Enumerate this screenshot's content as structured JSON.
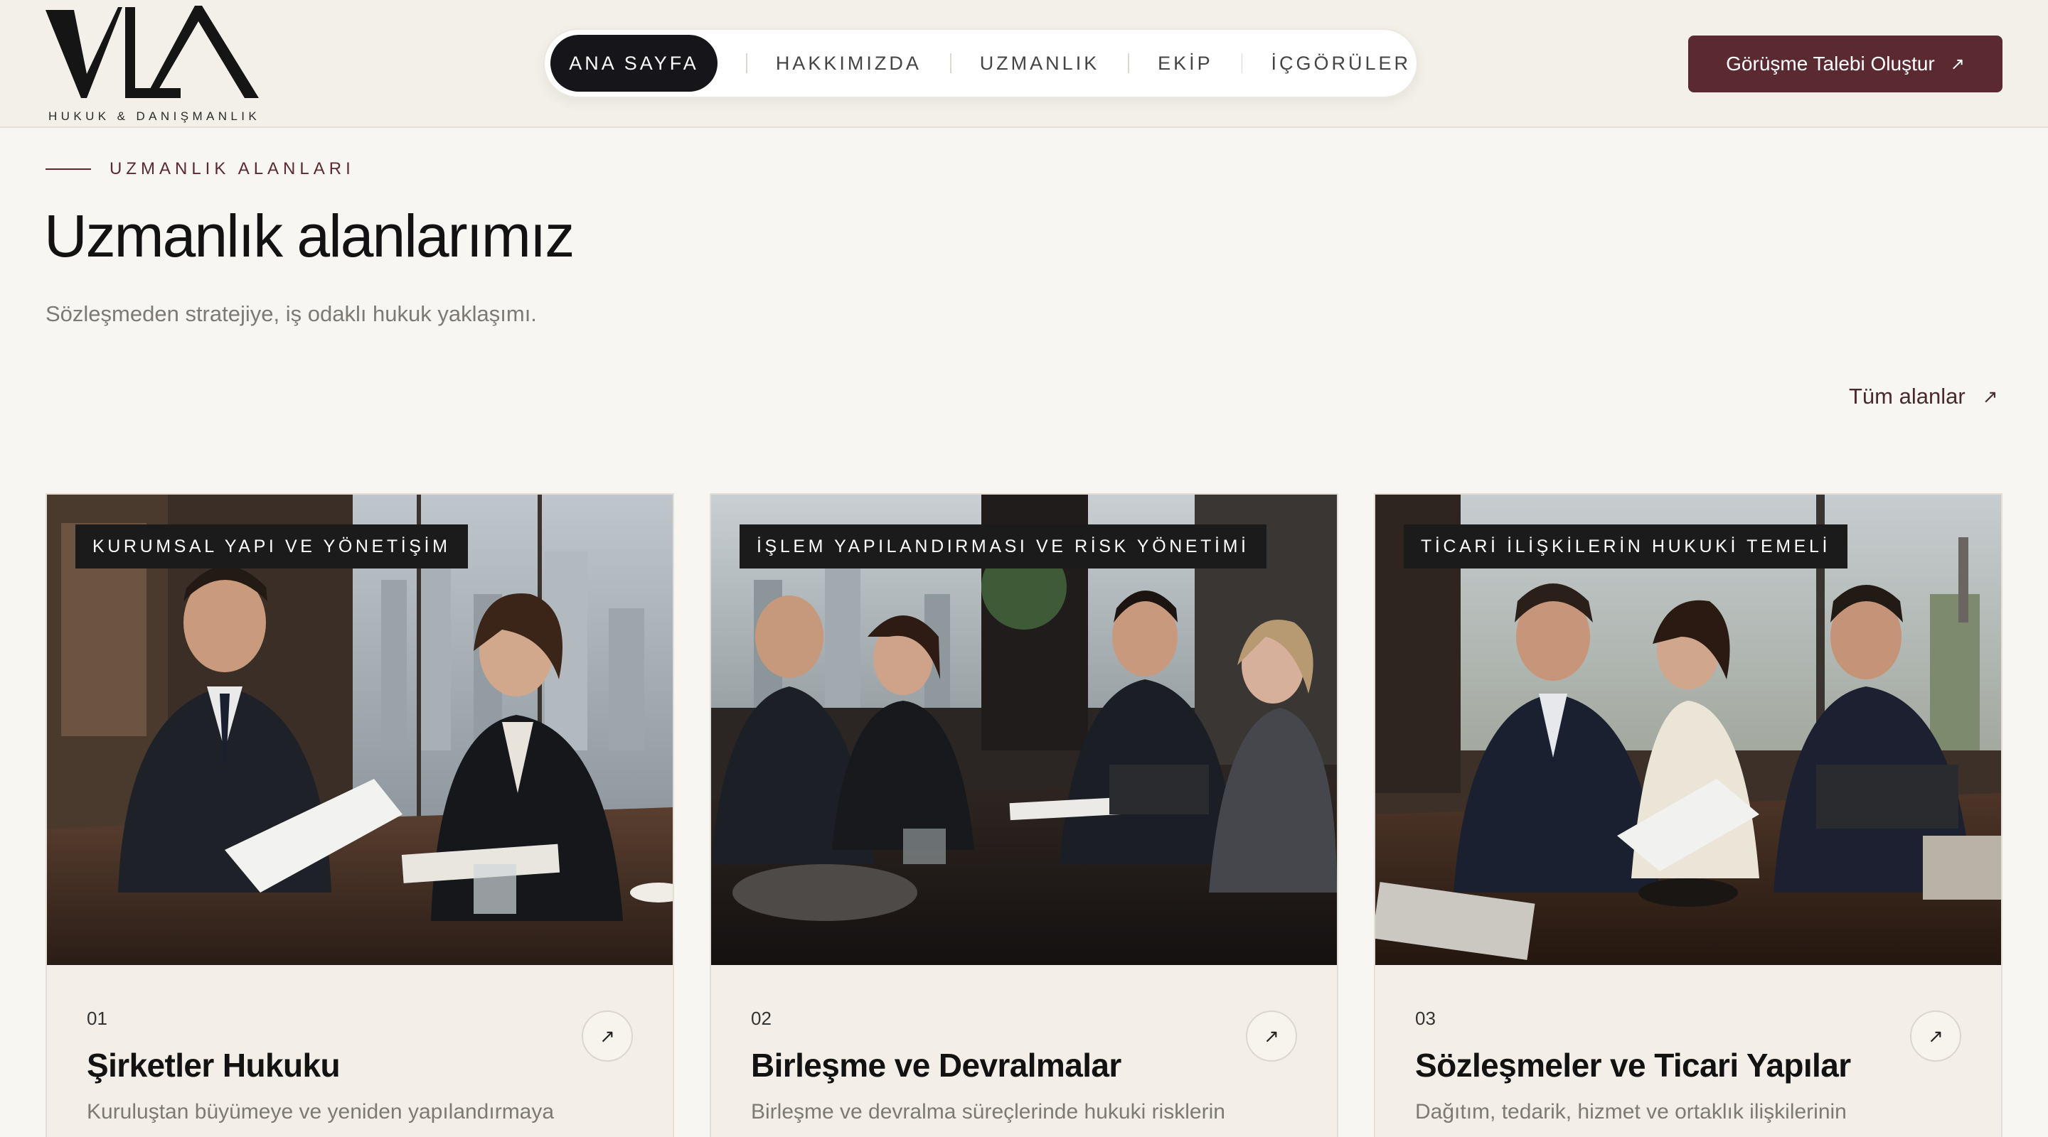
{
  "header": {
    "logo_text": "VLA",
    "logo_subtitle": "HUKUK & DANIŞMANLIK",
    "nav": [
      {
        "label": "ANA SAYFA",
        "active": true
      },
      {
        "label": "HAKKIMIZDA",
        "active": false
      },
      {
        "label": "UZMANLIK",
        "active": false
      },
      {
        "label": "EKİP",
        "active": false
      },
      {
        "label": "İÇGÖRÜLER",
        "active": false
      }
    ],
    "cta_label": "Görüşme Talebi Oluştur",
    "cta_icon": "arrow-up-right-icon"
  },
  "section": {
    "eyebrow": "UZMANLIK ALANLARI",
    "title": "Uzmanlık alanlarımız",
    "subtitle": "Sözleşmeden stratejiye, iş odaklı hukuk yaklaşımı.",
    "all_link": "Tüm alanlar"
  },
  "cards": [
    {
      "tag": "KURUMSAL YAPI VE YÖNETİŞİM",
      "number": "01",
      "title": "Şirketler Hukuku",
      "description": "Kuruluştan büyümeye ve yeniden yapılandırmaya"
    },
    {
      "tag": "İŞLEM YAPILANDIRMASI VE RİSK YÖNETİMİ",
      "number": "02",
      "title": "Birleşme ve Devralmalar",
      "description": "Birleşme ve devralma süreçlerinde hukuki risklerin"
    },
    {
      "tag": "TİCARİ İLİŞKİLERİN HUKUKİ TEMELİ",
      "number": "03",
      "title": "Sözleşmeler ve Ticari Yapılar",
      "description": "Dağıtım, tedarik, hizmet ve ortaklık ilişkilerinin"
    }
  ],
  "colors": {
    "background": "#f8f6f2",
    "accent": "#5b2a30",
    "dark": "#16161a",
    "muted_text": "#7d7a75"
  }
}
